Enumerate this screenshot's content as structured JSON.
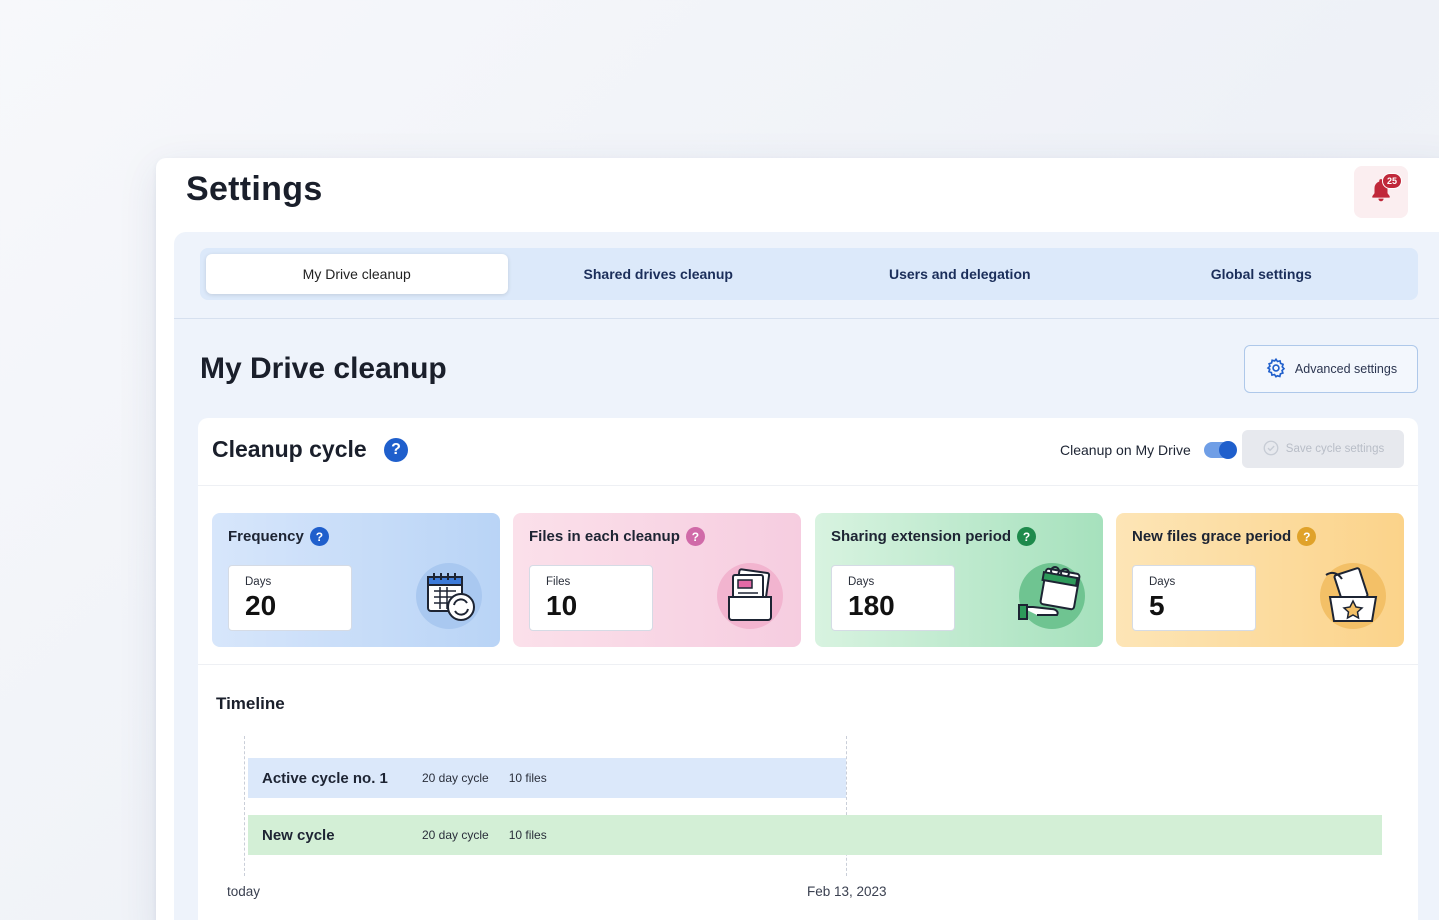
{
  "header": {
    "title": "Settings",
    "notifications_count": "25"
  },
  "tabs": [
    {
      "label": "My Drive cleanup",
      "active": true
    },
    {
      "label": "Shared drives cleanup",
      "active": false
    },
    {
      "label": "Users and delegation",
      "active": false
    },
    {
      "label": "Global settings",
      "active": false
    }
  ],
  "section": {
    "title": "My Drive cleanup",
    "advanced_label": "Advanced settings"
  },
  "cycle": {
    "title": "Cleanup cycle",
    "toggle_label": "Cleanup on My Drive",
    "toggle_on": true,
    "save_label": "Save cycle settings",
    "help_glyph": "?"
  },
  "metrics": [
    {
      "title": "Frequency",
      "unit": "Days",
      "value": "20",
      "help_color": "#1f5fcc",
      "icon": "calendar-refresh-icon"
    },
    {
      "title": "Files in each cleanup",
      "unit": "Files",
      "value": "10",
      "help_color": "#d06aa8",
      "icon": "folder-files-icon"
    },
    {
      "title": "Sharing extension period",
      "unit": "Days",
      "value": "180",
      "help_color": "#1e8a4c",
      "icon": "hand-calendar-icon"
    },
    {
      "title": "New files grace period",
      "unit": "Days",
      "value": "5",
      "help_color": "#e0a22a",
      "icon": "box-star-icon"
    }
  ],
  "timeline": {
    "title": "Timeline",
    "bars": [
      {
        "label": "Active cycle no. 1",
        "cycle": "20 day cycle",
        "files": "10 files"
      },
      {
        "label": "New cycle",
        "cycle": "20 day cycle",
        "files": "10 files"
      }
    ],
    "start_label": "today",
    "end_label": "Feb 13, 2023"
  }
}
